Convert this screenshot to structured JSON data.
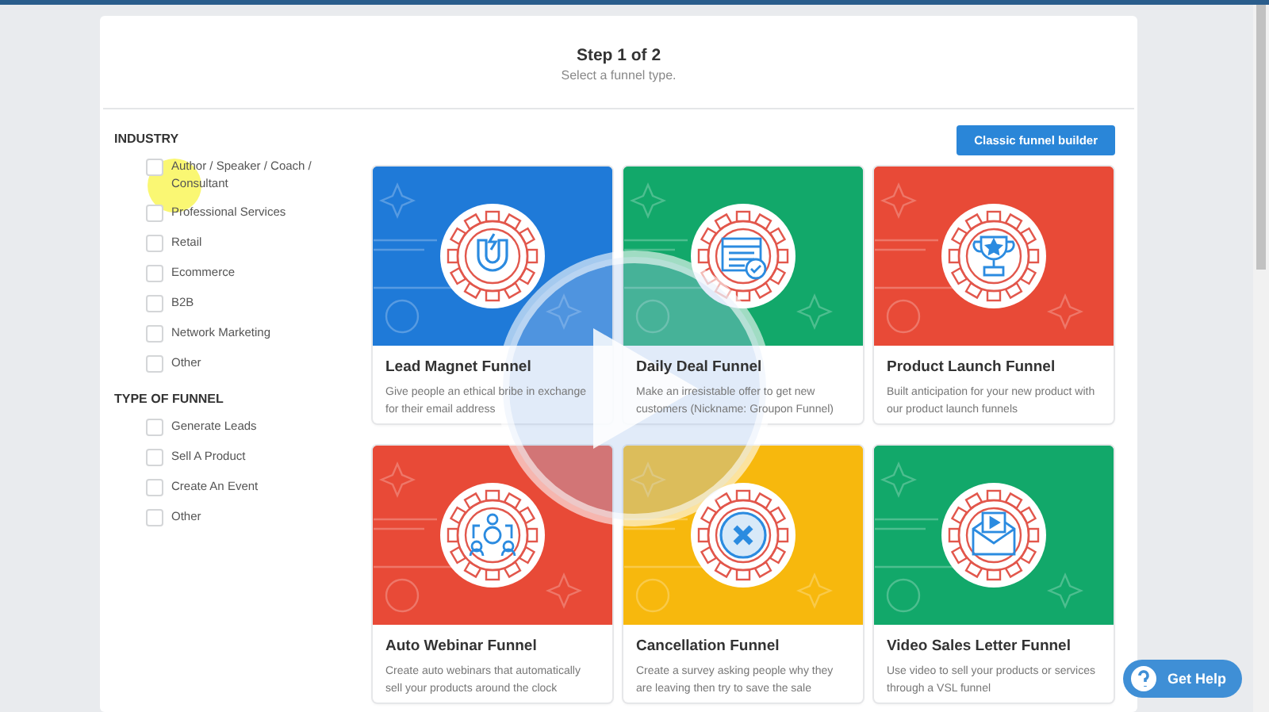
{
  "header": {
    "title": "Step 1 of 2",
    "subtitle": "Select a funnel type."
  },
  "filters": [
    {
      "heading": "INDUSTRY",
      "options": [
        {
          "label": "Author / Speaker / Coach / Consultant",
          "checked": false
        },
        {
          "label": "Professional Services",
          "checked": false
        },
        {
          "label": "Retail",
          "checked": false
        },
        {
          "label": "Ecommerce",
          "checked": false
        },
        {
          "label": "B2B",
          "checked": false
        },
        {
          "label": "Network Marketing",
          "checked": false
        },
        {
          "label": "Other",
          "checked": false
        }
      ]
    },
    {
      "heading": "TYPE OF FUNNEL",
      "options": [
        {
          "label": "Generate Leads",
          "checked": false
        },
        {
          "label": "Sell A Product",
          "checked": false
        },
        {
          "label": "Create An Event",
          "checked": false
        },
        {
          "label": "Other",
          "checked": false
        }
      ]
    }
  ],
  "classic_button": "Classic funnel builder",
  "funnels": [
    {
      "kind": "magnet",
      "color": "#1f7ad8",
      "title": "Lead Magnet Funnel",
      "description": "Give people an ethical bribe in exchange for their email address"
    },
    {
      "kind": "calendar",
      "color": "#12a86a",
      "title": "Daily Deal Funnel",
      "description": "Make an irresistable offer to get new customers (Nickname: Groupon Funnel)"
    },
    {
      "kind": "trophy",
      "color": "#e84a37",
      "title": "Product Launch Funnel",
      "description": "Built anticipation for your new product with our product launch funnels"
    },
    {
      "kind": "webinar",
      "color": "#e84a37",
      "title": "Auto Webinar Funnel",
      "description": "Create auto webinars that automatically sell your products around the clock"
    },
    {
      "kind": "cancel",
      "color": "#f7b80d",
      "title": "Cancellation Funnel",
      "description": "Create a survey asking people why they are leaving then try to save the sale"
    },
    {
      "kind": "video",
      "color": "#12a86a",
      "title": "Video Sales Letter Funnel",
      "description": "Use video to sell your products or services through a VSL funnel"
    }
  ],
  "help_button": "Get Help"
}
